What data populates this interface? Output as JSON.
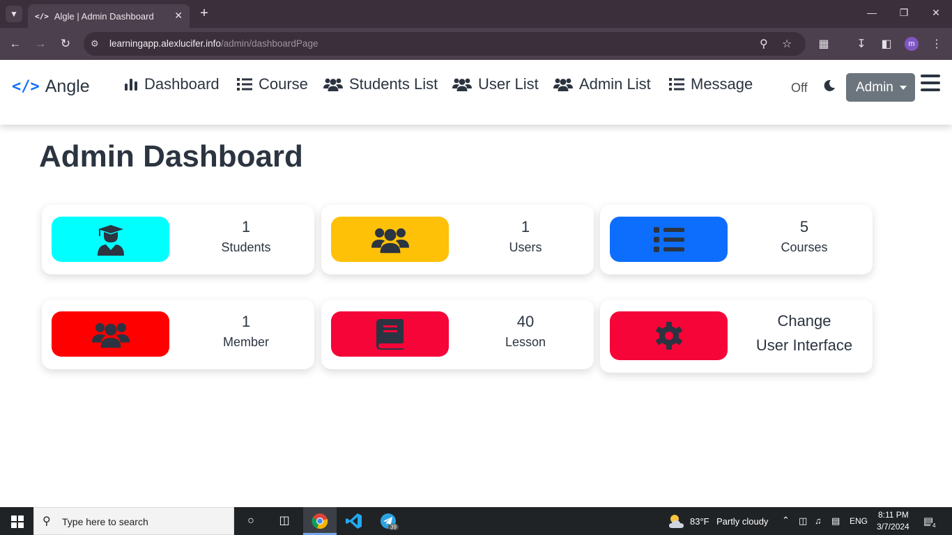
{
  "browser": {
    "tab_title": "Algle | Admin Dashboard",
    "tab_favicon": "</>",
    "url_host": "learningapp.alexlucifer.info",
    "url_path": "/admin/dashboardPage",
    "profile_initial": "m"
  },
  "navbar": {
    "brand_code": "</>",
    "brand_name": "Angle",
    "links": [
      {
        "label": "Dashboard",
        "icon": "bar-chart-icon"
      },
      {
        "label": "Course",
        "icon": "list-icon"
      },
      {
        "label": "Students List",
        "icon": "users-icon"
      },
      {
        "label": "User List",
        "icon": "users-icon"
      },
      {
        "label": "Admin List",
        "icon": "users-icon"
      },
      {
        "label": "Message",
        "icon": "list-icon"
      }
    ],
    "theme_toggle_label": "Off",
    "admin_label": "Admin"
  },
  "main": {
    "title": "Admin Dashboard",
    "cards": [
      {
        "value": "1",
        "label": "Students",
        "color": "#00ffff",
        "icon": "graduate-icon"
      },
      {
        "value": "1",
        "label": "Users",
        "color": "#ffc107",
        "icon": "users-icon"
      },
      {
        "value": "5",
        "label": "Courses",
        "color": "#0d6efd",
        "icon": "list-icon"
      },
      {
        "value": "1",
        "label": "Member",
        "color": "#ff0000",
        "icon": "users-icon"
      },
      {
        "value": "40",
        "label": "Lesson",
        "color": "#f50538",
        "icon": "book-icon"
      },
      {
        "line1": "Change",
        "line2": "User Interface",
        "color": "#f50538",
        "icon": "gear-icon"
      }
    ]
  },
  "taskbar": {
    "search_placeholder": "Type here to search",
    "telegram_badge": "39",
    "weather_temp": "83°F",
    "weather_desc": "Partly cloudy",
    "language": "ENG",
    "time": "8:11 PM",
    "date": "3/7/2024",
    "notification_count": "4"
  },
  "colors": {
    "accent": "#0d6efd",
    "text": "#2b3440",
    "admin_button": "#6c757d"
  }
}
